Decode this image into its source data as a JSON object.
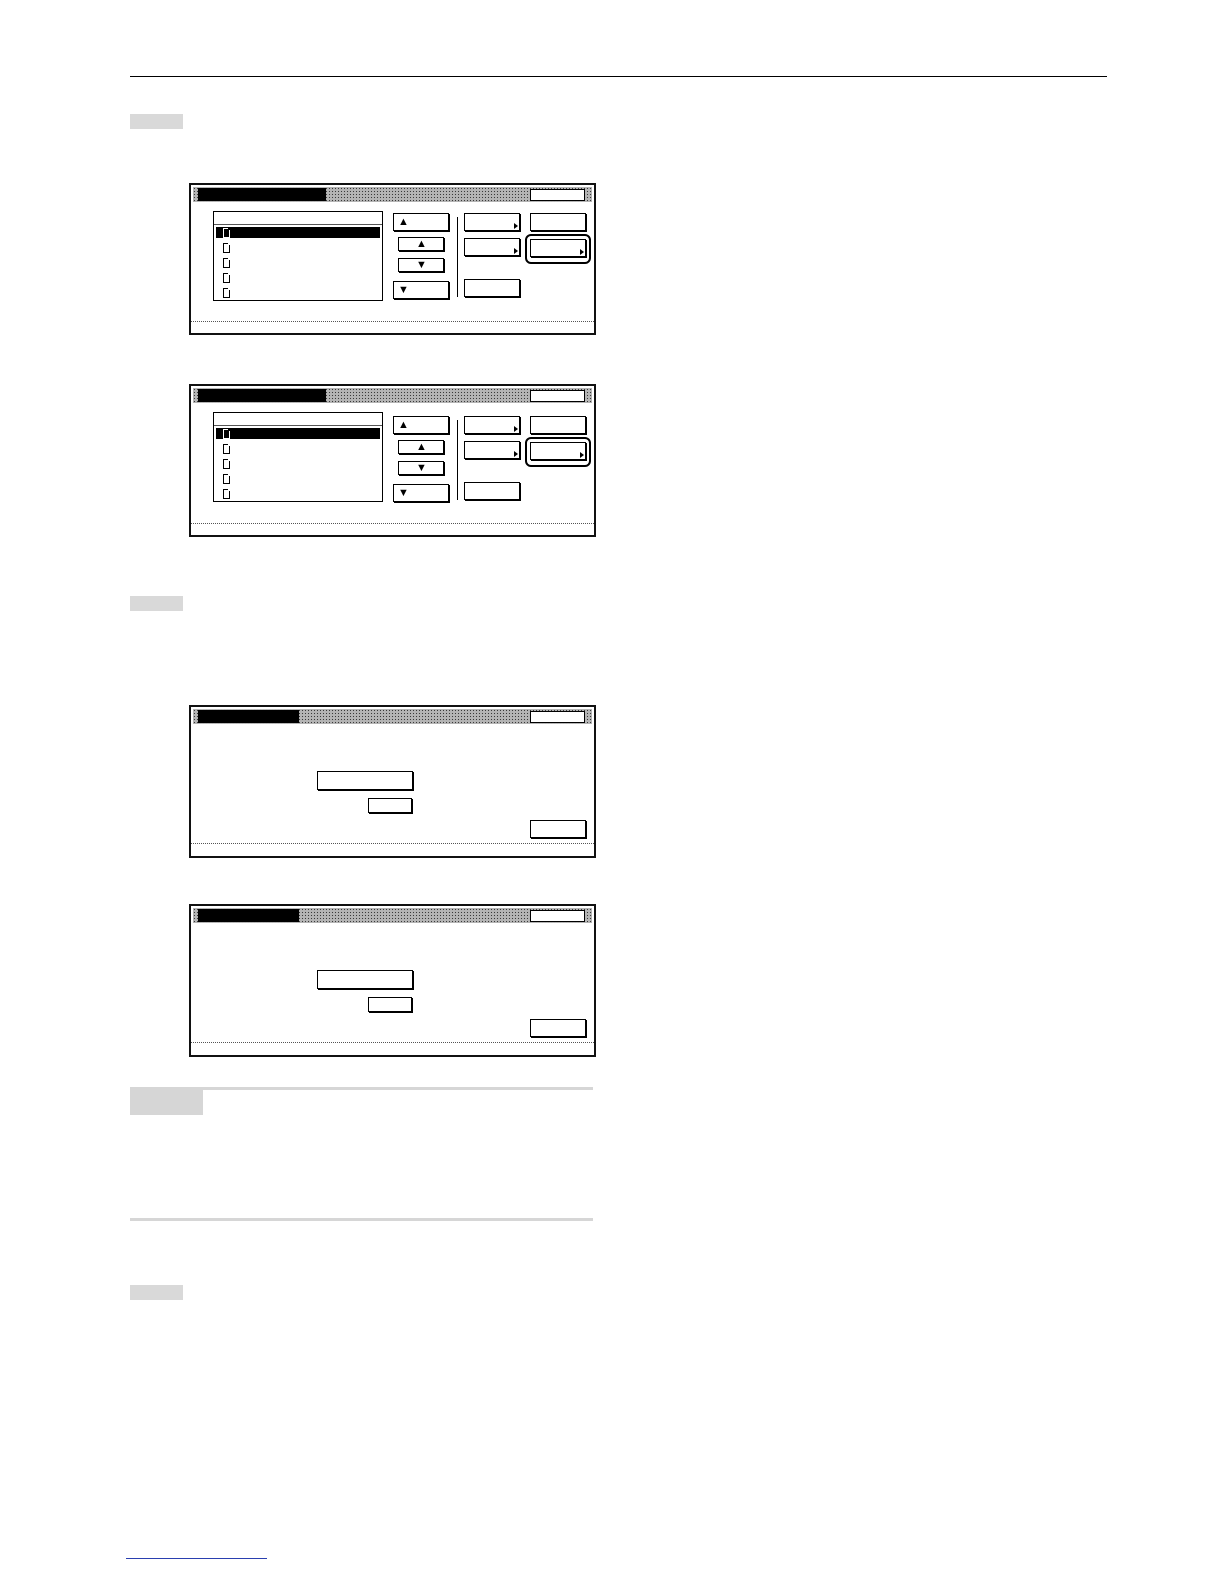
{
  "page": {
    "header_rule": "",
    "steps": [
      {
        "badge": ""
      },
      {
        "badge": ""
      },
      {
        "badge": ""
      }
    ],
    "note": {
      "label": ""
    },
    "footer_link": ""
  },
  "list_screen": {
    "title": "",
    "list_header": "",
    "rows": [
      "",
      "",
      "",
      "",
      ""
    ],
    "selected_index": 0,
    "buttons": {
      "page_up": "",
      "up": "",
      "down": "",
      "page_down": "",
      "menu_a": "",
      "menu_b": "",
      "menu_c": "",
      "menu_d": "",
      "menu_e": "",
      "close": ""
    },
    "highlighted_button": "menu_e"
  },
  "input_screen": {
    "title": "",
    "field_value": "",
    "small_button": "",
    "close_button": "",
    "top_right_button": ""
  }
}
